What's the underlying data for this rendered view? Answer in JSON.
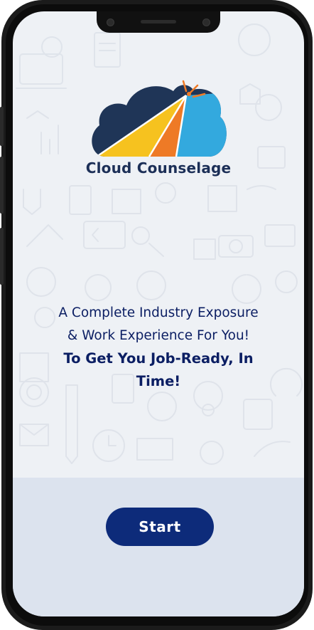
{
  "brand": {
    "name": "Cloud Counselage"
  },
  "tagline": {
    "line1": "A Complete Industry Exposure",
    "line2": "& Work Experience For You!",
    "line3": "To Get You Job-Ready, In",
    "line4": "Time!"
  },
  "actions": {
    "start_label": "Start"
  },
  "colors": {
    "primary": "#0d2b7a",
    "cloud_dark": "#1f3557",
    "ray_yellow": "#f6c21f",
    "ray_orange": "#ee7a26",
    "ray_blue": "#33a9de",
    "screen_bg": "#eef1f5",
    "panel_bg": "#dce3ee"
  },
  "icons": [
    "cloud-logo-icon",
    "background-doodle-icons"
  ]
}
